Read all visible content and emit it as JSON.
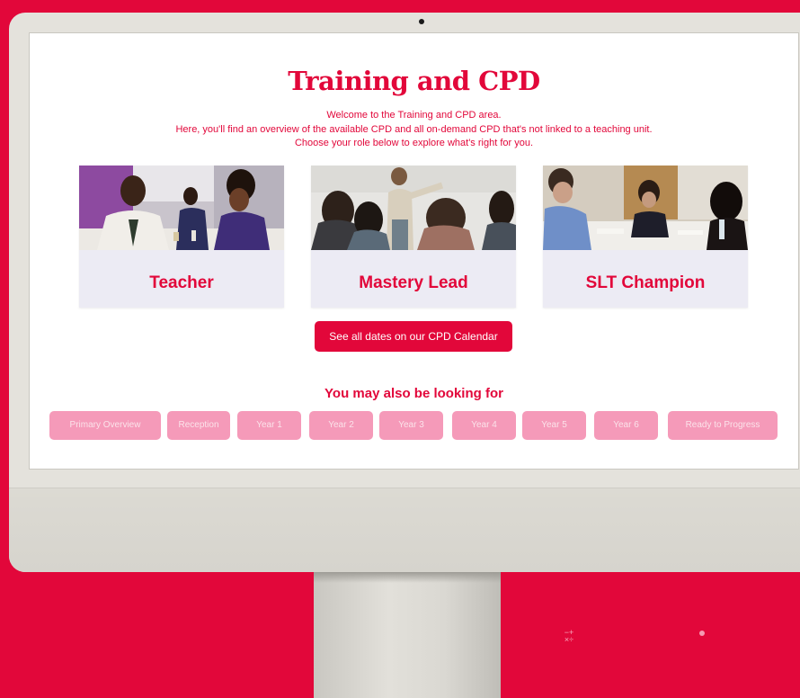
{
  "page": {
    "title": "Training and CPD",
    "intro_lines": [
      "Welcome to the Training and CPD area.",
      "Here, you'll find an overview of the available CPD and all on-demand CPD that's not linked to a teaching unit.",
      "Choose your role below to explore what's right for you."
    ]
  },
  "roles": [
    {
      "label": "Teacher",
      "photo": "teacher-classroom-photo"
    },
    {
      "label": "Mastery Lead",
      "photo": "presenter-training-photo"
    },
    {
      "label": "SLT Champion",
      "photo": "meeting-table-photo"
    }
  ],
  "calendar_button": "See all dates on our CPD Calendar",
  "also_heading": "You may also be looking for",
  "links": [
    "Primary Overview",
    "Reception",
    "Year 1",
    "Year 2",
    "Year 3",
    "Year 4",
    "Year 5",
    "Year 6",
    "Ready to Progress"
  ],
  "colors": {
    "brand": "#e2073a",
    "chip": "#f59ab9",
    "card_bg": "#ecebf4",
    "monitor": "#e4e2dc"
  },
  "decor": {
    "math_symbols": "−+\n×÷"
  }
}
